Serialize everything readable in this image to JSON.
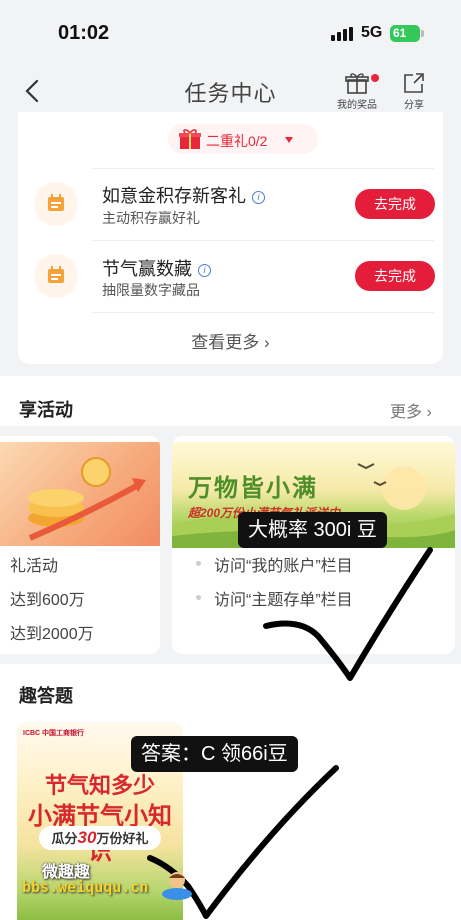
{
  "status_bar": {
    "time": "01:02",
    "network": "5G",
    "battery": "61"
  },
  "nav": {
    "title": "任务中心",
    "rewards_label": "我的奖品",
    "share_label": "分享"
  },
  "task_card": {
    "reward_chip": "二重礼0/2",
    "tasks": [
      {
        "title": "如意金积存新客礼",
        "subtitle": "主动积存赢好礼",
        "button": "去完成"
      },
      {
        "title": "节气赢数藏",
        "subtitle": "抽限量数字藏品",
        "button": "去完成"
      }
    ],
    "more": "查看更多"
  },
  "activities": {
    "title": "享活动",
    "more": "更多",
    "card1": {
      "lines": [
        "礼活动",
        "达到600万",
        "达到2000万"
      ]
    },
    "card2": {
      "banner_title": "万物皆小满",
      "banner_sub": "超200万份小满节气礼派送中",
      "lines": [
        "访问“我的账户”栏目",
        "访问“主题存单”栏目"
      ]
    }
  },
  "overlays": {
    "label1": "大概率 300i 豆",
    "label2": "答案：C  领66i豆"
  },
  "quiz": {
    "title": "趣答题",
    "bank_name": "ICBC 中国工商银行",
    "line1": "节气知多少",
    "line2": "小满节气小知识",
    "line3_prefix": "瓜分",
    "line3_number": "30",
    "line3_suffix": "万份好礼"
  },
  "watermark": {
    "line1": "微趣趣",
    "line2": "bbs.weiququ.cn"
  },
  "colors": {
    "accent": "#e41e3a",
    "link_info": "#4a7fd4",
    "banner_green": "#4f8f2a"
  }
}
